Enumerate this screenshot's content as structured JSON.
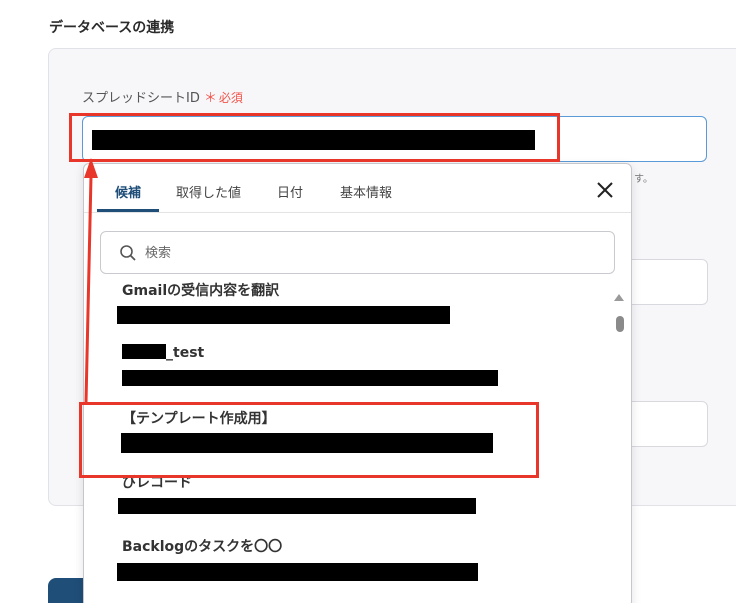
{
  "section": {
    "title": "データベースの連携"
  },
  "field": {
    "label": "スプレッドシートID",
    "required_mark": "＊",
    "required_text": "必須",
    "hint_tail": "す。"
  },
  "dropdown": {
    "tabs": [
      {
        "label": "候補",
        "active": true
      },
      {
        "label": "取得した値",
        "active": false
      },
      {
        "label": "日付",
        "active": false
      },
      {
        "label": "基本情報",
        "active": false
      }
    ],
    "search": {
      "placeholder": "検索",
      "value": ""
    },
    "items": [
      {
        "title": "Gmailの受信内容を翻訳"
      },
      {
        "title_suffix": "_test"
      },
      {
        "title": "【テンプレート作成用】"
      },
      {
        "title": "びレコード"
      },
      {
        "title": "Backlogのタスクを〇〇"
      }
    ]
  },
  "colors": {
    "accent": "#1f4e79",
    "required": "#f2554a",
    "annotation": "#e8362a",
    "input_border_focus": "#5b9ad8"
  }
}
